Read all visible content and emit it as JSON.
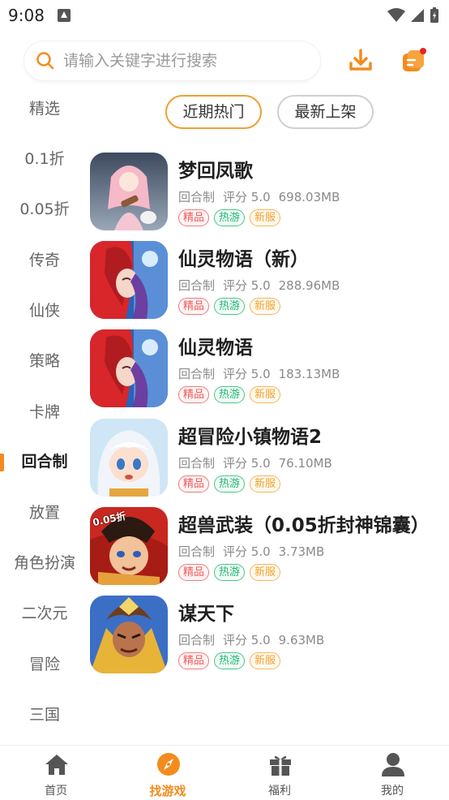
{
  "status_bar": {
    "time": "9:08"
  },
  "search": {
    "placeholder": "请输入关键字进行搜索"
  },
  "colors": {
    "accent": "#f28c1e",
    "tag_red": "#ef5858",
    "tag_green": "#22b573",
    "tag_orange": "#f2a02a"
  },
  "sidebar": {
    "items": [
      {
        "label": "精选"
      },
      {
        "label": "0.1折"
      },
      {
        "label": "0.05折"
      },
      {
        "label": "传奇"
      },
      {
        "label": "仙侠"
      },
      {
        "label": "策略"
      },
      {
        "label": "卡牌"
      },
      {
        "label": "回合制"
      },
      {
        "label": "放置"
      },
      {
        "label": "角色扮演"
      },
      {
        "label": "二次元"
      },
      {
        "label": "冒险"
      },
      {
        "label": "三国"
      }
    ],
    "active": "回合制"
  },
  "tabs": [
    {
      "label": "近期热门"
    },
    {
      "label": "最新上架"
    }
  ],
  "games": [
    {
      "name": "梦回凤歌",
      "genre": "回合制",
      "rating": "评分 5.0",
      "size": "698.03MB",
      "tags": [
        "精品",
        "热游",
        "新服"
      ]
    },
    {
      "name": "仙灵物语（新）",
      "genre": "回合制",
      "rating": "评分 5.0",
      "size": "288.96MB",
      "tags": [
        "精品",
        "热游",
        "新服"
      ]
    },
    {
      "name": "仙灵物语",
      "genre": "回合制",
      "rating": "评分 5.0",
      "size": "183.13MB",
      "tags": [
        "精品",
        "热游",
        "新服"
      ]
    },
    {
      "name": "超冒险小镇物语2",
      "genre": "回合制",
      "rating": "评分 5.0",
      "size": "76.10MB",
      "tags": [
        "精品",
        "热游",
        "新服"
      ]
    },
    {
      "name": "超兽武装（0.05折封神锦囊）",
      "genre": "回合制",
      "rating": "评分 5.0",
      "size": "3.73MB",
      "tags": [
        "精品",
        "热游",
        "新服"
      ],
      "icon_badge": "0.05折"
    },
    {
      "name": "谋天下",
      "genre": "回合制",
      "rating": "评分 5.0",
      "size": "9.63MB",
      "tags": [
        "精品",
        "热游",
        "新服"
      ]
    }
  ],
  "bottom_nav": [
    {
      "label": "首页",
      "icon": "home-icon"
    },
    {
      "label": "找游戏",
      "icon": "compass-icon"
    },
    {
      "label": "福利",
      "icon": "gift-icon"
    },
    {
      "label": "我的",
      "icon": "user-icon"
    }
  ]
}
